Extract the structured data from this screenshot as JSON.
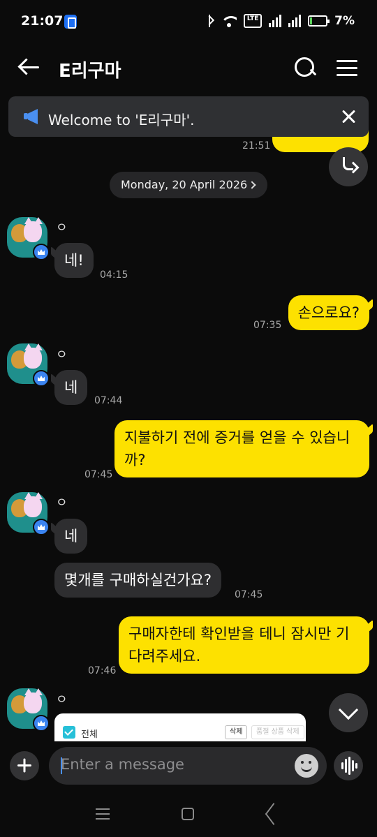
{
  "status_bar": {
    "time": "21:07",
    "battery": "7%"
  },
  "header": {
    "title": "E리구마"
  },
  "notice": {
    "text": "Welcome to 'E리구마'."
  },
  "partial_message": {
    "time": "21:51"
  },
  "date_chip": {
    "label": "Monday, 20 April 2026"
  },
  "messages": [
    {
      "sender": "ㅇ",
      "text": "네!",
      "time": "04:15"
    },
    {
      "text": "손으로요?",
      "time": "07:35"
    },
    {
      "sender": "ㅇ",
      "text": "네",
      "time": "07:44"
    },
    {
      "text_line1": "지불하기 전에 증거를 얻을 수 있습니",
      "text_line2": "까?",
      "time": "07:45"
    },
    {
      "sender": "ㅇ",
      "text": "네",
      "text2": "몇개를 구매하실건가요?",
      "time": "07:45"
    },
    {
      "text_line1": "구매자한테 확인받을 테니 잠시만 기",
      "text_line2": "다려주세요.",
      "time": "07:46"
    },
    {
      "sender": "ㅇ",
      "card_all_label": "전체",
      "card_delete": "삭제",
      "card_delete_soldout": "품절 상품 삭제"
    }
  ],
  "input": {
    "placeholder": "Enter a message"
  },
  "colors": {
    "background": "#0b0b0b",
    "outgoing_bubble": "#fde100",
    "incoming_bubble": "#2e2e30",
    "accent_blue": "#3b84f0"
  },
  "icons": [
    "back-arrow-icon",
    "search-icon",
    "hamburger-menu-icon",
    "megaphone-icon",
    "close-icon",
    "reply-icon",
    "chevron-right-icon",
    "crown-icon",
    "plus-icon",
    "emoji-icon",
    "voice-icon",
    "chevron-down-icon"
  ]
}
